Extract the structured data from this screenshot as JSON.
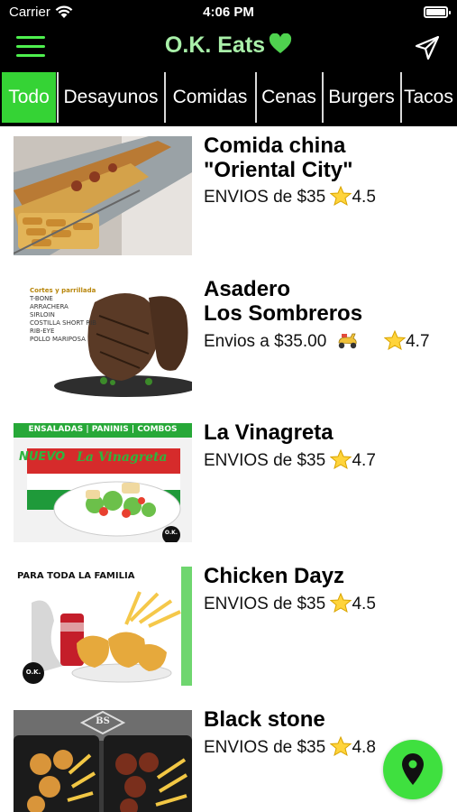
{
  "status_bar": {
    "carrier": "Carrier",
    "time": "4:06 PM"
  },
  "header": {
    "title": "O.K. Eats",
    "title_icon": "green-heart-icon",
    "menu_icon": "hamburger-menu-icon",
    "action_icon": "paper-plane-icon"
  },
  "tabs": [
    {
      "label": "Todo",
      "active": true
    },
    {
      "label": "Desayunos",
      "active": false
    },
    {
      "label": "Comidas",
      "active": false
    },
    {
      "label": "Cenas",
      "active": false
    },
    {
      "label": "Burgers",
      "active": false
    },
    {
      "label": "Tacos",
      "active": false
    }
  ],
  "restaurants": [
    {
      "name": "Comida china\n\"Oriental City\"",
      "delivery": "ENVIOS de $35",
      "rating": "4.5",
      "image": {
        "kind": "buffet",
        "texts": []
      }
    },
    {
      "name": "Asadero\nLos Sombreros",
      "delivery": "Envios a $35.00",
      "rating": "4.7",
      "image": {
        "kind": "steak",
        "texts": [
          "Cortes y parrillada",
          "T-BONE",
          "ARRACHERA",
          "SIRLOIN",
          "COSTILLA SHORT RIB",
          "RIB-EYE",
          "POLLO MARIPOSA"
        ]
      }
    },
    {
      "name": "La Vinagreta",
      "delivery": "ENVIOS de $35",
      "rating": "4.7",
      "image": {
        "kind": "salad",
        "texts": [
          "ENSALADAS",
          "PANINIS",
          "COMBOS",
          "NUEVO",
          "La Vinagreta",
          "O.K."
        ]
      }
    },
    {
      "name": "Chicken Dayz",
      "delivery": "ENVIOS de $35",
      "rating": "4.5",
      "image": {
        "kind": "chicken",
        "texts": [
          "PARA TODA LA FAMILIA",
          "O.K."
        ]
      }
    },
    {
      "name": "Black stone",
      "delivery": "ENVIOS de $35",
      "rating": "4.8",
      "image": {
        "kind": "wings",
        "texts": [
          "BS"
        ]
      }
    }
  ],
  "fab": {
    "icon": "map-pin-icon"
  },
  "colors": {
    "accent": "#35d335",
    "title": "#a9f0a9",
    "fab": "#3fe03f",
    "bar": "#000000"
  }
}
